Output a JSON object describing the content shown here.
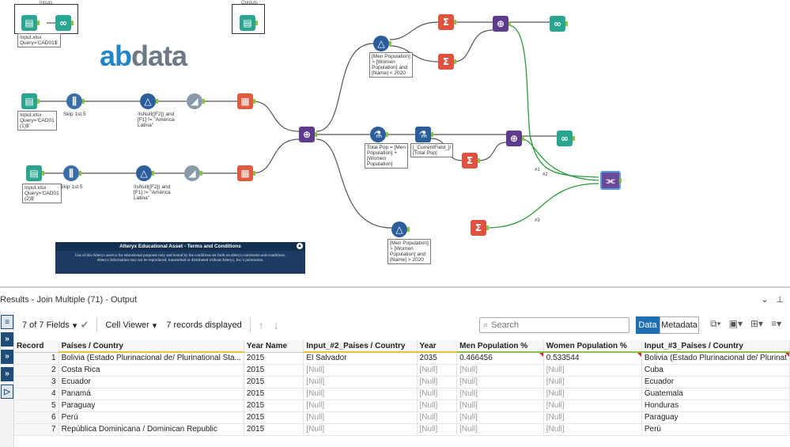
{
  "canvas": {
    "logo": {
      "ab": "ab",
      "data": "data"
    },
    "boxes": {
      "inputs_label": "Inputs",
      "outputs_label": "Outputs"
    },
    "annotations": {
      "input_top": "Input.xlsx\nQuery='CAD01$'",
      "input1": "Input.xlsx\nQuery='CAD01\n(1)$'",
      "input2": "Input.xlsx\nQuery='CAD01\n(2)$'",
      "select1": "Skip 1st 5",
      "select2": "Skip 1st 5",
      "filter1": "!IsNull([F2]) and\n[F1] != \"América\nLatina\"",
      "filter2": "!IsNull([F2]) and\n[F1] != \"América\nLatina\"",
      "filter_top": "[Men Population]\n> [Women\nPopulation] and\n[Name] < 2020",
      "formula": "Total Pop = [Men\nPopulation] +\n[Women\nPopulation]",
      "multifield": "[_CurrentField_]/\n[Total Pop]",
      "filter_bottom": "[Men Population]\n> [Women\nPopulation] and\n[Name] > 2020"
    },
    "wire_labels": {
      "w1": "#1",
      "w2": "#2",
      "w3": "#3"
    },
    "notice": {
      "title": "Alteryx Educational Asset - Terms and Conditions",
      "body": "Use of this Alteryx asset is for educational purposes only and bound by the conditions set forth on alteryx.com/terms-and-conditions. Alteryx Information may not be reproduced, transmitted or distributed without Alteryx, Inc.'s permission."
    },
    "icons": {
      "input": "book-icon",
      "browse": "binoculars-icon",
      "select": "select-icon",
      "filter": "filter-icon",
      "formula": "formula-icon",
      "summarize": "sigma-icon",
      "join": "join-icon",
      "sample": "sample-icon",
      "table": "table-icon",
      "join_multiple": "join-multiple-icon",
      "multifield": "multifield-formula-icon"
    }
  },
  "results": {
    "title": "Results - Join Multiple (71) - Output",
    "fields_label": "7 of 7 Fields",
    "cell_viewer_label": "Cell Viewer",
    "records_label": "7 records displayed",
    "search_placeholder": "Search",
    "data_button": "Data",
    "metadata_button": "Metadata",
    "columns": [
      "Record",
      "Países / Country",
      "Year Name",
      "Input_#2_Países / Country",
      "Year",
      "Men Population %",
      "Women Population %",
      "Input_#3_Países / Country"
    ],
    "rows": [
      [
        "1",
        "Bolivia (Estado Plurinacional de/ Plurinational Sta...",
        "2015",
        "El Salvador",
        "2035",
        "0.466456",
        "0.533544",
        "Bolivia (Estado Plurinacional de/ Plurinat"
      ],
      [
        "2",
        "Costa Rica",
        "2015",
        "[Null]",
        "[Null]",
        "[Null]",
        "[Null]",
        "Cuba"
      ],
      [
        "3",
        "Ecuador",
        "2015",
        "[Null]",
        "[Null]",
        "[Null]",
        "[Null]",
        "Ecuador"
      ],
      [
        "4",
        "Panamá",
        "2015",
        "[Null]",
        "[Null]",
        "[Null]",
        "[Null]",
        "Guatemala"
      ],
      [
        "5",
        "Paraguay",
        "2015",
        "[Null]",
        "[Null]",
        "[Null]",
        "[Null]",
        "Honduras"
      ],
      [
        "6",
        "Perú",
        "2015",
        "[Null]",
        "[Null]",
        "[Null]",
        "[Null]",
        "Paraguay"
      ],
      [
        "7",
        "República Dominicana / Dominican Republic",
        "2015",
        "[Null]",
        "[Null]",
        "[Null]",
        "[Null]",
        "Perú"
      ]
    ],
    "accent_color": "#1f6fb5"
  }
}
